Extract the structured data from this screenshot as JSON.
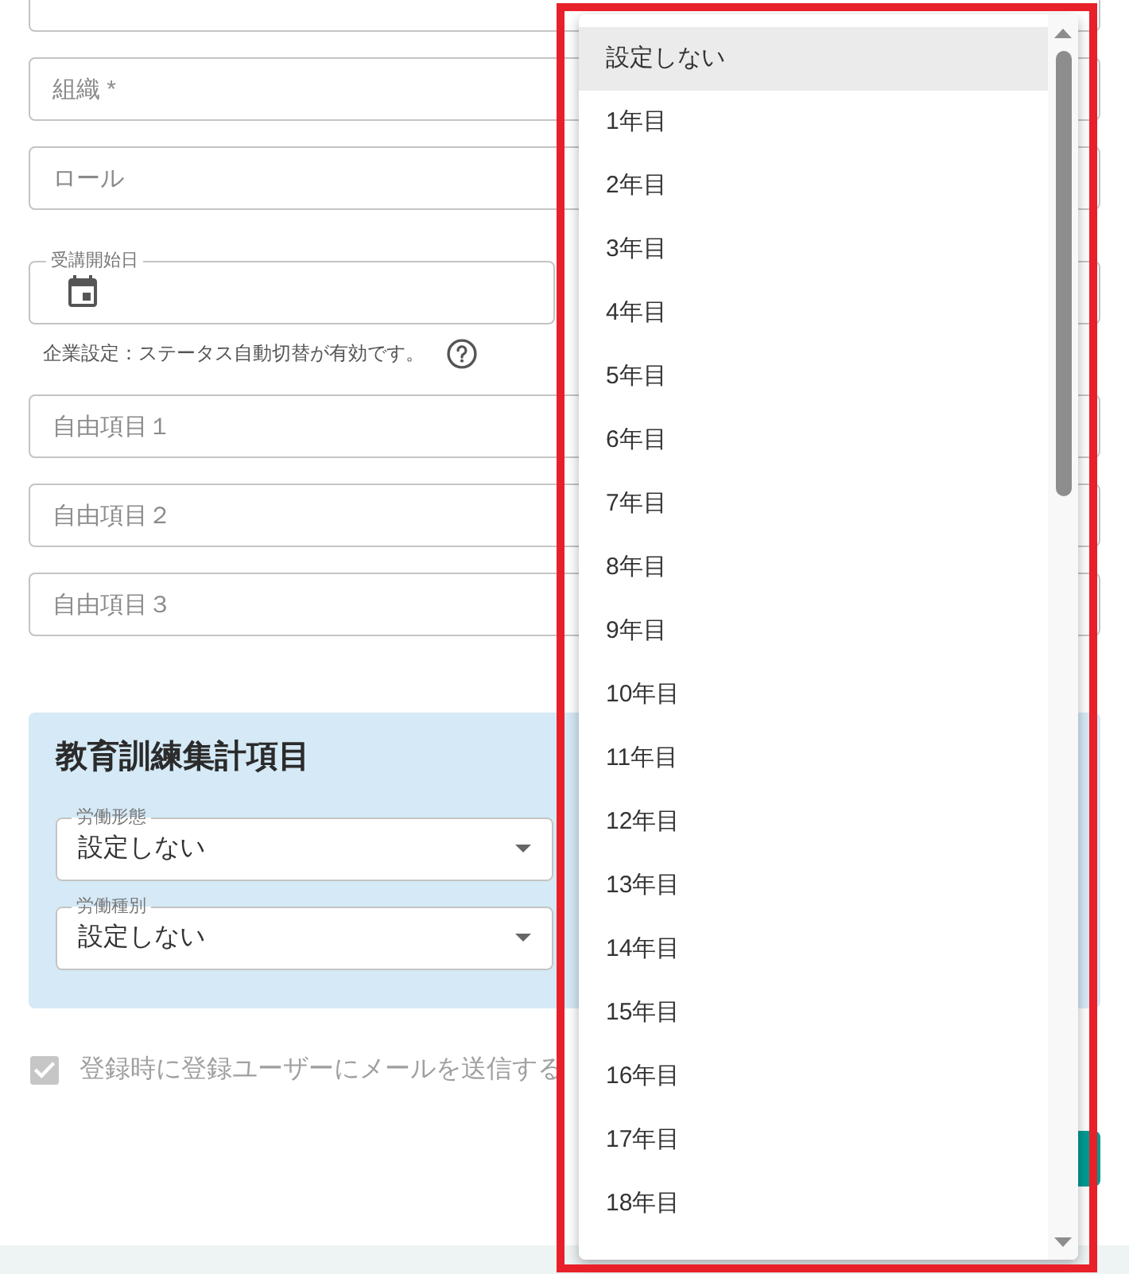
{
  "fields": [
    {
      "kind": "text",
      "placeholder": "組織 *"
    },
    {
      "kind": "text",
      "placeholder": "ロール"
    },
    {
      "kind": "date",
      "label": "受講開始日",
      "hint": "企業設定：ステータス自動切替が有効です。"
    },
    {
      "kind": "text",
      "placeholder": "自由項目１"
    },
    {
      "kind": "text",
      "placeholder": "自由項目２"
    },
    {
      "kind": "text",
      "placeholder": "自由項目３"
    }
  ],
  "training_panel": {
    "title": "教育訓練集計項目",
    "selects": [
      {
        "label": "労働形態",
        "value": "設定しない"
      },
      {
        "label": "労働種別",
        "value": "設定しない"
      }
    ]
  },
  "mail_option": {
    "label": "登録時に登録ユーザーにメールを送信する",
    "checked": true,
    "disabled": true
  },
  "dropdown": {
    "options": [
      {
        "label": "設定しない",
        "selected": true
      },
      {
        "label": "1年目",
        "selected": false
      },
      {
        "label": "2年目",
        "selected": false
      },
      {
        "label": "3年目",
        "selected": false
      },
      {
        "label": "4年目",
        "selected": false
      },
      {
        "label": "5年目",
        "selected": false
      },
      {
        "label": "6年目",
        "selected": false
      },
      {
        "label": "7年目",
        "selected": false
      },
      {
        "label": "8年目",
        "selected": false
      },
      {
        "label": "9年目",
        "selected": false
      },
      {
        "label": "10年目",
        "selected": false
      },
      {
        "label": "11年目",
        "selected": false
      },
      {
        "label": "12年目",
        "selected": false
      },
      {
        "label": "13年目",
        "selected": false
      },
      {
        "label": "14年目",
        "selected": false
      },
      {
        "label": "15年目",
        "selected": false
      },
      {
        "label": "16年目",
        "selected": false
      },
      {
        "label": "17年目",
        "selected": false
      },
      {
        "label": "18年目",
        "selected": false
      }
    ]
  }
}
